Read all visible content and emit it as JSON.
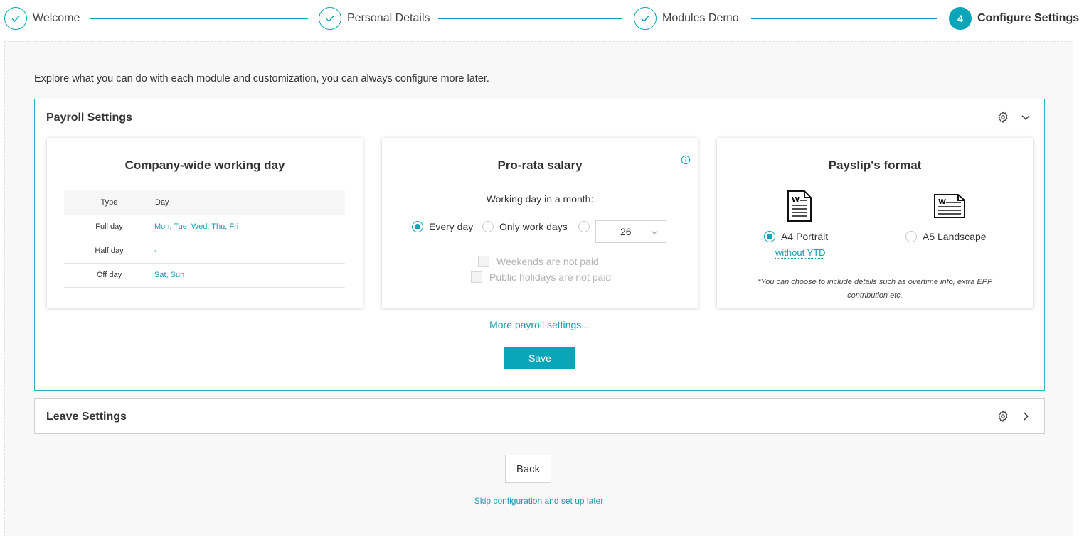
{
  "stepper": {
    "steps": [
      {
        "label": "Welcome",
        "state": "done",
        "icon": "check-icon"
      },
      {
        "label": "Personal Details",
        "state": "done",
        "icon": "check-icon"
      },
      {
        "label": "Modules Demo",
        "state": "done",
        "icon": "check-icon"
      },
      {
        "label": "Configure Settings",
        "state": "active",
        "number": "4"
      }
    ]
  },
  "intro_text": "Explore what you can do with each module and customization, you can always configure more later.",
  "payroll": {
    "title": "Payroll Settings",
    "working_day_card": {
      "title": "Company-wide working day",
      "columns": [
        "Type",
        "Day"
      ],
      "rows": [
        {
          "type": "Full day",
          "day": "Mon, Tue, Wed, Thu, Fri"
        },
        {
          "type": "Half day",
          "day": "-"
        },
        {
          "type": "Off day",
          "day": "Sat, Sun"
        }
      ]
    },
    "prorata_card": {
      "title": "Pro-rata salary",
      "subtitle": "Working day in a month:",
      "options": [
        "Every day",
        "Only work days"
      ],
      "selected": "Every day",
      "custom_days_value": "26",
      "checkbox_weekends": "Weekends are not paid",
      "checkbox_holidays": "Public holidays are not paid"
    },
    "payslip_card": {
      "title": "Payslip's format",
      "option_a4": "A4 Portrait",
      "option_a4_sub": "without YTD",
      "option_a5": "A5 Landscape",
      "selected": "A4 Portrait",
      "note": "*You can choose to include details such as overtime info, extra EPF contribution etc."
    },
    "more_link": "More payroll settings...",
    "save_label": "Save"
  },
  "leave": {
    "title": "Leave Settings"
  },
  "back_label": "Back",
  "skip_label": "Skip configuration and set up later",
  "colors": {
    "accent": "#0aa5b8",
    "link": "#1a9cb0"
  }
}
